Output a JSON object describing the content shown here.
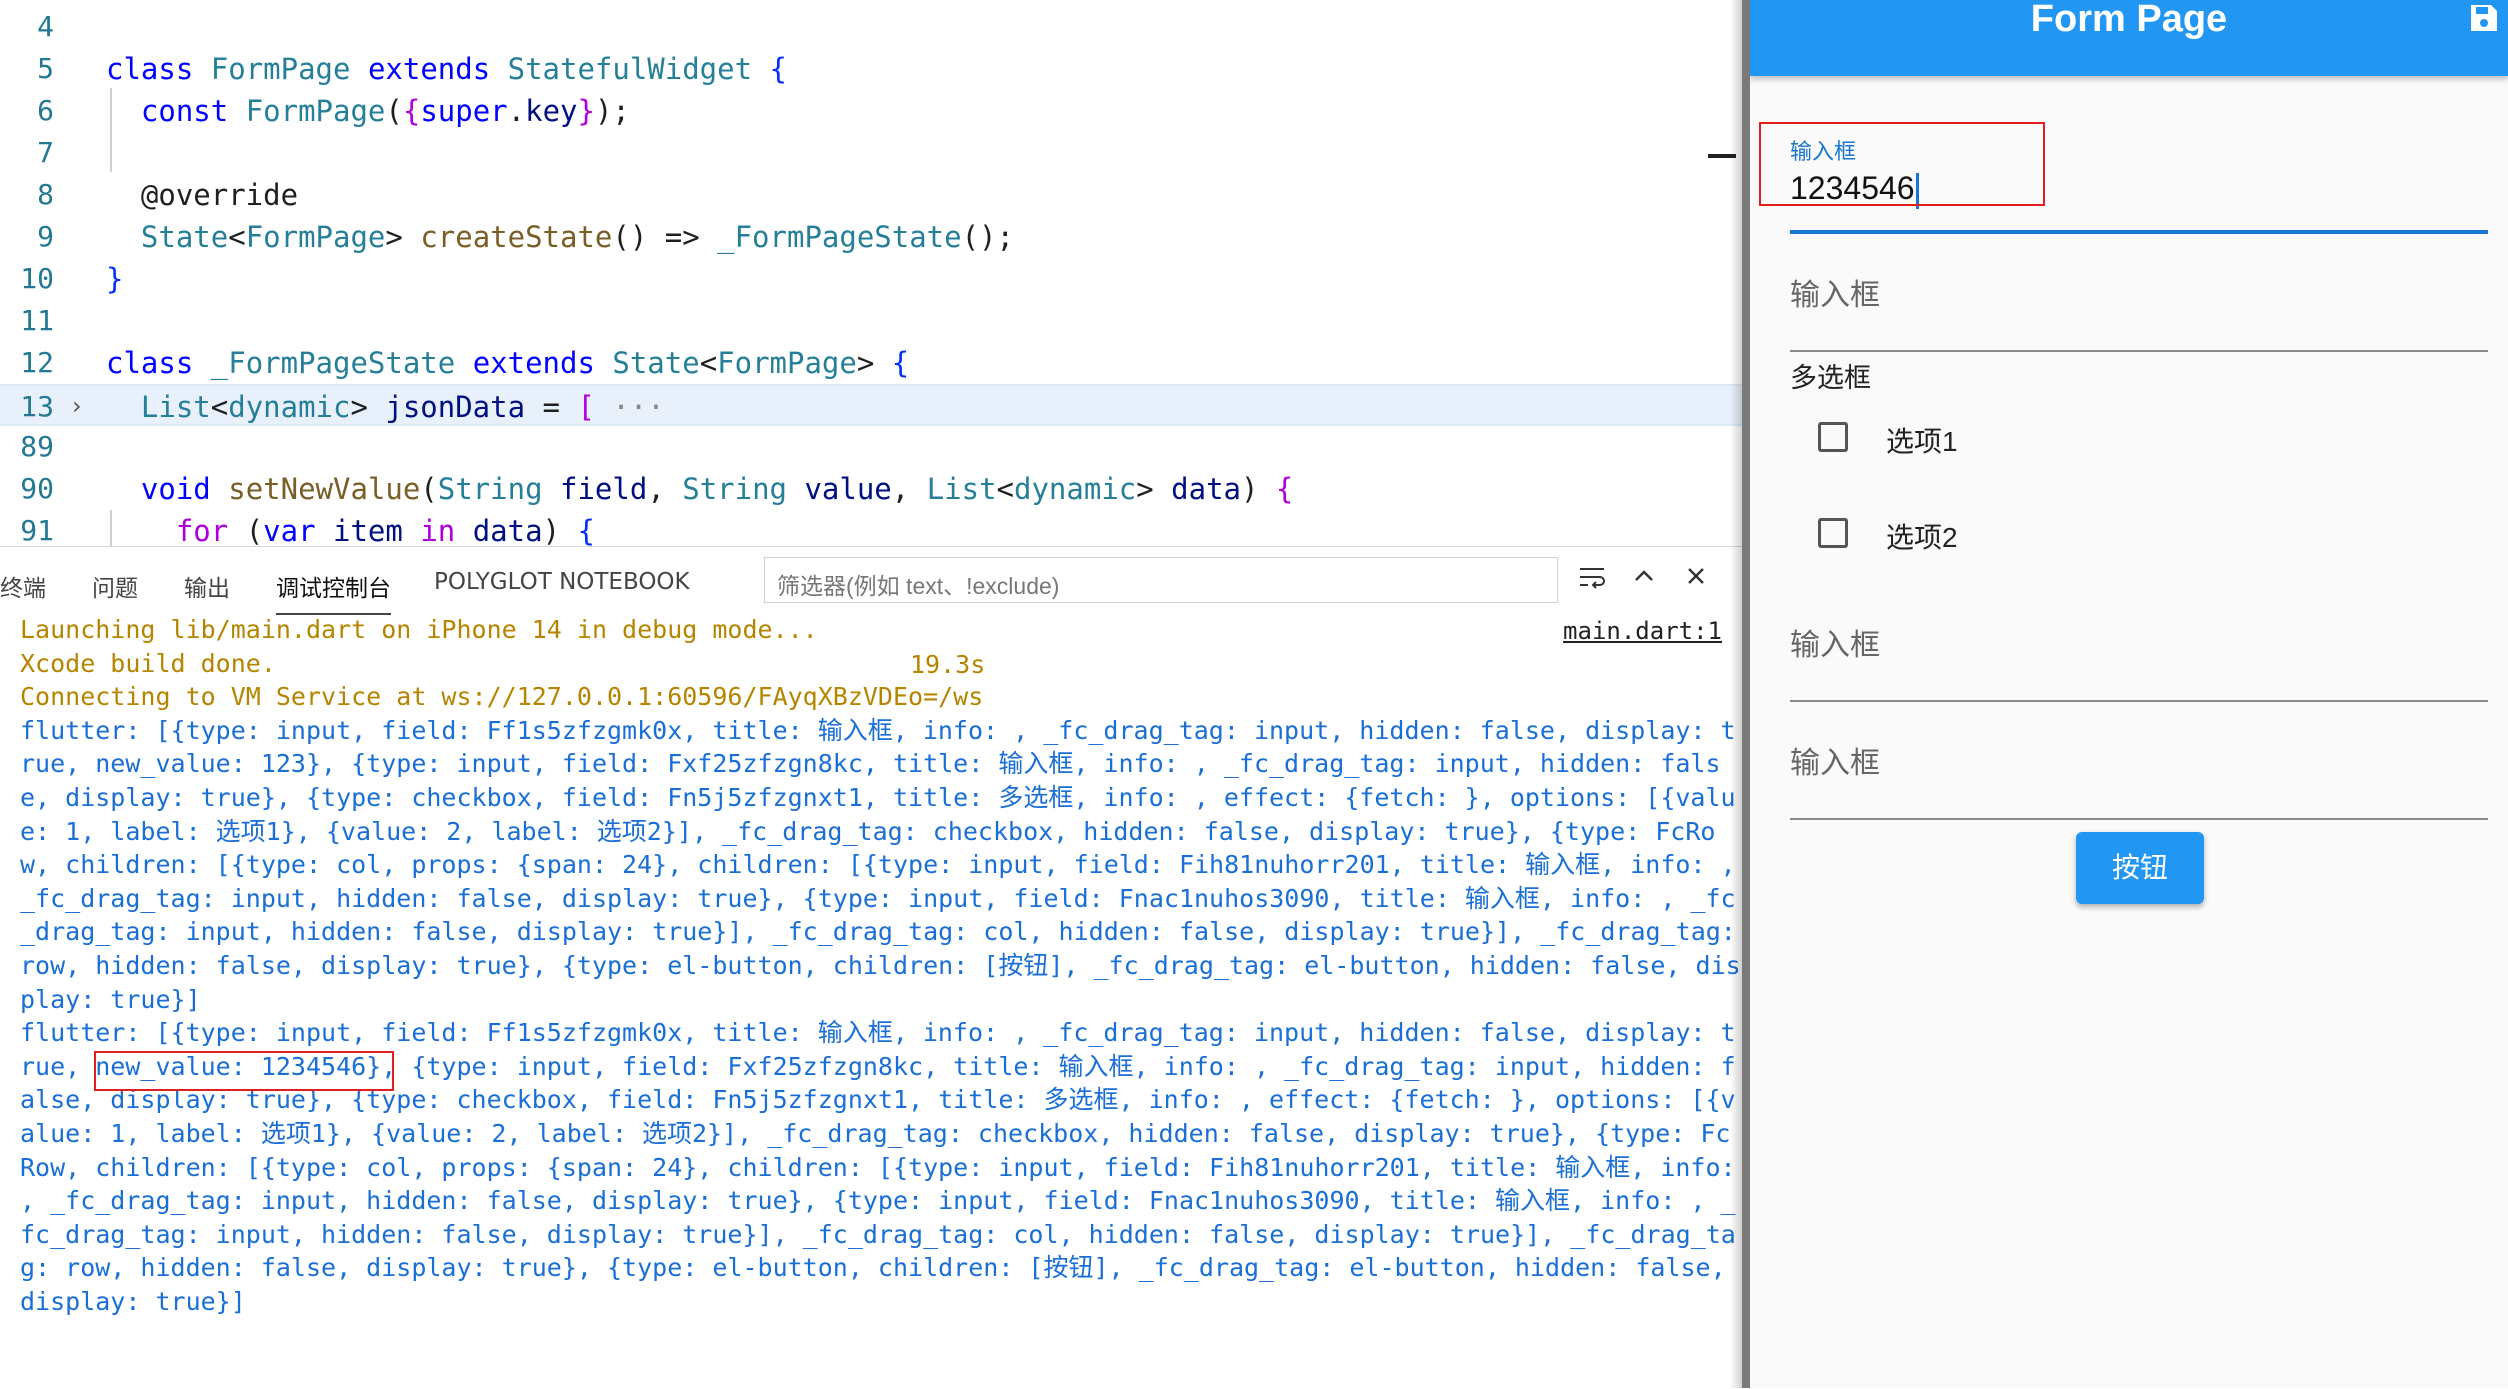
{
  "editor": {
    "lines": [
      {
        "num": "4",
        "code": ""
      },
      {
        "num": "5",
        "code": "class FormPage extends StatefulWidget {"
      },
      {
        "num": "6",
        "code": "  const FormPage({super.key});"
      },
      {
        "num": "7",
        "code": ""
      },
      {
        "num": "8",
        "code": "  @override"
      },
      {
        "num": "9",
        "code": "  State<FormPage> createState() => _FormPageState();"
      },
      {
        "num": "10",
        "code": "}"
      },
      {
        "num": "11",
        "code": ""
      },
      {
        "num": "12",
        "code": "class _FormPageState extends State<FormPage> {"
      },
      {
        "num": "13",
        "code": "  List<dynamic> jsonData = [",
        "folded": "···"
      },
      {
        "num": "89",
        "code": ""
      },
      {
        "num": "90",
        "code": "  void setNewValue(String field, String value, List<dynamic> data) {"
      },
      {
        "num": "91",
        "code": "    for (var item in data) {"
      }
    ]
  },
  "panel": {
    "tabs": [
      "终端",
      "问题",
      "输出",
      "调试控制台",
      "POLYGLOT NOTEBOOK"
    ],
    "active_tab": "调试控制台",
    "filter_placeholder": "筛选器(例如 text、!exclude)",
    "source_link": "main.dart:1",
    "build_time": "19.3s",
    "console_lines": [
      "Launching lib/main.dart on iPhone 14 in debug mode...",
      "Xcode build done.",
      "Connecting to VM Service at ws://127.0.0.1:60596/FAyqXBzVDEo=/ws",
      "flutter: [{type: input, field: Ff1s5zfzgmk0x, title: 输入框, info: , _fc_drag_tag: input, hidden: false, display: t",
      "rue, new_value: 123}, {type: input, field: Fxf25zfzgn8kc, title: 输入框, info: , _fc_drag_tag: input, hidden: fals",
      "e, display: true}, {type: checkbox, field: Fn5j5zfzgnxt1, title: 多选框, info: , effect: {fetch: }, options: [{valu",
      "e: 1, label: 选项1}, {value: 2, label: 选项2}], _fc_drag_tag: checkbox, hidden: false, display: true}, {type: FcRo",
      "w, children: [{type: col, props: {span: 24}, children: [{type: input, field: Fih81nuhorr201, title: 输入框, info: ,",
      "_fc_drag_tag: input, hidden: false, display: true}, {type: input, field: Fnac1nuhos3090, title: 输入框, info: , _fc",
      "_drag_tag: input, hidden: false, display: true}], _fc_drag_tag: col, hidden: false, display: true}], _fc_drag_tag:",
      "row, hidden: false, display: true}, {type: el-button, children: [按钮], _fc_drag_tag: el-button, hidden: false, dis",
      "play: true}]",
      "flutter: [{type: input, field: Ff1s5zfzgmk0x, title: 输入框, info: , _fc_drag_tag: input, hidden: false, display: t",
      "rue, new_value: 1234546}, {type: input, field: Fxf25zfzgn8kc, title: 输入框, info: , _fc_drag_tag: input, hidden: f",
      "alse, display: true}, {type: checkbox, field: Fn5j5zfzgnxt1, title: 多选框, info: , effect: {fetch: }, options: [{v",
      "alue: 1, label: 选项1}, {value: 2, label: 选项2}], _fc_drag_tag: checkbox, hidden: false, display: true}, {type: Fc",
      "Row, children: [{type: col, props: {span: 24}, children: [{type: input, field: Fih81nuhorr201, title: 输入框, info:",
      ", _fc_drag_tag: input, hidden: false, display: true}, {type: input, field: Fnac1nuhos3090, title: 输入框, info: , _",
      "fc_drag_tag: input, hidden: false, display: true}], _fc_drag_tag: col, hidden: false, display: true}], _fc_drag_ta",
      "g: row, hidden: false, display: true}, {type: el-button, children: [按钮], _fc_drag_tag: el-button, hidden: false,",
      "display: true}]"
    ]
  },
  "app": {
    "title": "Form Page",
    "save_icon": "save-icon",
    "field1_label": "输入框",
    "field1_value": "1234546",
    "field2_hint": "输入框",
    "checkbox_group_label": "多选框",
    "options": [
      {
        "label": "选项1",
        "checked": false
      },
      {
        "label": "选项2",
        "checked": false
      }
    ],
    "field3_hint": "输入框",
    "field4_hint": "输入框",
    "button_label": "按钮"
  },
  "colors": {
    "appbar": "#2196f3",
    "accent": "#1976d2",
    "console_text": "#1a6fd6",
    "console_status": "#b58500",
    "highlight_box": "#e02020"
  }
}
